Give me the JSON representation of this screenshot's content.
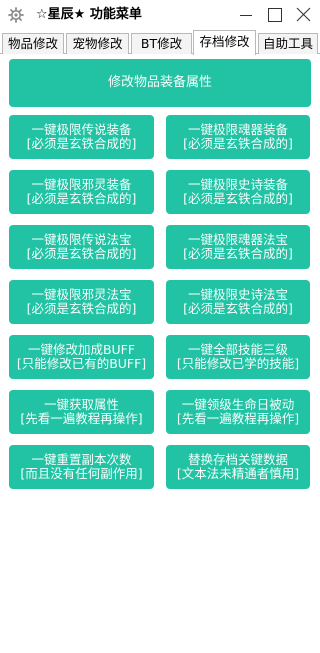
{
  "window": {
    "title": "☆星辰★ 功能菜单",
    "icons": {
      "app": "app-gear-icon",
      "minimize": "minimize-icon",
      "maximize": "maximize-icon",
      "close": "close-icon"
    }
  },
  "tabs": [
    {
      "label": "物品修改",
      "active": false
    },
    {
      "label": "宠物修改",
      "active": false
    },
    {
      "label": "BT修改",
      "active": false
    },
    {
      "label": "存档修改",
      "active": true
    },
    {
      "label": "自助工具",
      "active": false
    }
  ],
  "main": {
    "wide_button": "修改物品装备属性",
    "buttons": [
      {
        "line1": "一键极限传说装备",
        "line2": "[必须是玄铁合成的]"
      },
      {
        "line1": "一键极限魂器装备",
        "line2": "[必须是玄铁合成的]"
      },
      {
        "line1": "一键极限邪灵装备",
        "line2": "[必须是玄铁合成的]"
      },
      {
        "line1": "一键极限史诗装备",
        "line2": "[必须是玄铁合成的]"
      },
      {
        "line1": "一键极限传说法宝",
        "line2": "[必须是玄铁合成的]"
      },
      {
        "line1": "一键极限魂器法宝",
        "line2": "[必须是玄铁合成的]"
      },
      {
        "line1": "一键极限邪灵法宝",
        "line2": "[必须是玄铁合成的]"
      },
      {
        "line1": "一键极限史诗法宝",
        "line2": "[必须是玄铁合成的]"
      },
      {
        "line1": "一键修改加成BUFF",
        "line2": "[只能修改已有的BUFF]"
      },
      {
        "line1": "一键全部技能三级",
        "line2": "[只能修改已学的技能]"
      },
      {
        "line1": "一键获取属性",
        "line2": "[先看一遍教程再操作]"
      },
      {
        "line1": "一键领级生命日被动",
        "line2": "[先看一遍教程再操作]"
      },
      {
        "line1": "一键重置副本次数",
        "line2": "[而且没有任何副作用]"
      },
      {
        "line1": "替换存档关键数据",
        "line2": "[文本法未精通者慎用]"
      }
    ]
  },
  "colors": {
    "button": "#21c3a4",
    "button_text": "#f3fffb",
    "tab_border": "#b9b9b9"
  }
}
